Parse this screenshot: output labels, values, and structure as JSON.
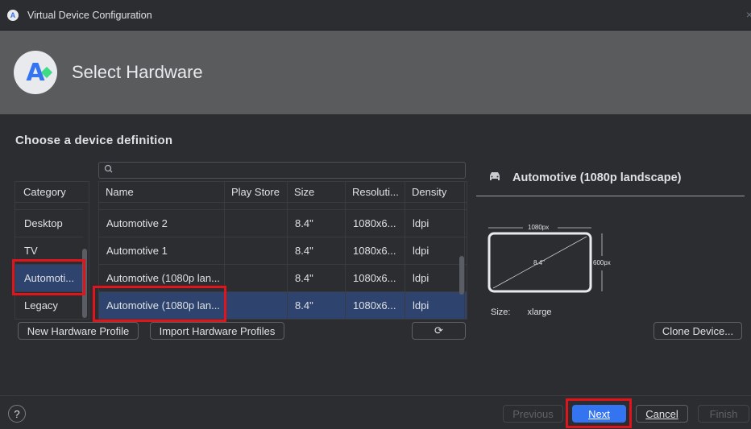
{
  "window": {
    "title": "Virtual Device Configuration",
    "close_glyph": "×"
  },
  "header": {
    "title": "Select Hardware"
  },
  "section_title": "Choose a device definition",
  "search": {
    "placeholder": "",
    "value": ""
  },
  "category": {
    "header": "Category",
    "items": [
      {
        "label": "Desktop",
        "selected": false
      },
      {
        "label": "TV",
        "selected": false
      },
      {
        "label": "Automoti...",
        "selected": true
      },
      {
        "label": "Legacy",
        "selected": false
      }
    ]
  },
  "table": {
    "headers": [
      "Name",
      "Play Store",
      "Size",
      "Resoluti...",
      "Density"
    ],
    "rows": [
      {
        "name": "Automotive 2",
        "play_store": "",
        "size": "8.4\"",
        "resolution": "1080x6...",
        "density": "ldpi",
        "selected": false
      },
      {
        "name": "Automotive 1",
        "play_store": "",
        "size": "8.4\"",
        "resolution": "1080x6...",
        "density": "ldpi",
        "selected": false
      },
      {
        "name": "Automotive (1080p lan...",
        "play_store": "",
        "size": "8.4\"",
        "resolution": "1080x6...",
        "density": "ldpi",
        "selected": false
      },
      {
        "name": "Automotive (1080p lan...",
        "play_store": "",
        "size": "8.4\"",
        "resolution": "1080x6...",
        "density": "ldpi",
        "selected": true
      }
    ]
  },
  "buttons": {
    "new_profile": "New Hardware Profile",
    "import_profiles": "Import Hardware Profiles",
    "refresh_glyph": "⟳",
    "clone": "Clone Device...",
    "previous": "Previous",
    "next": "Next",
    "cancel": "Cancel",
    "finish": "Finish",
    "help": "?"
  },
  "details": {
    "title": "Automotive (1080p landscape)",
    "width_label": "1080px",
    "height_label": "600px",
    "diagonal_label": "8.4\"",
    "size_label": "Size:",
    "size_value": "xlarge"
  },
  "colors": {
    "background": "#2b2d30",
    "header_band": "#5a5b5d",
    "selection": "#2e436e",
    "accent": "#3574f0",
    "highlight_box": "#e0141a"
  }
}
